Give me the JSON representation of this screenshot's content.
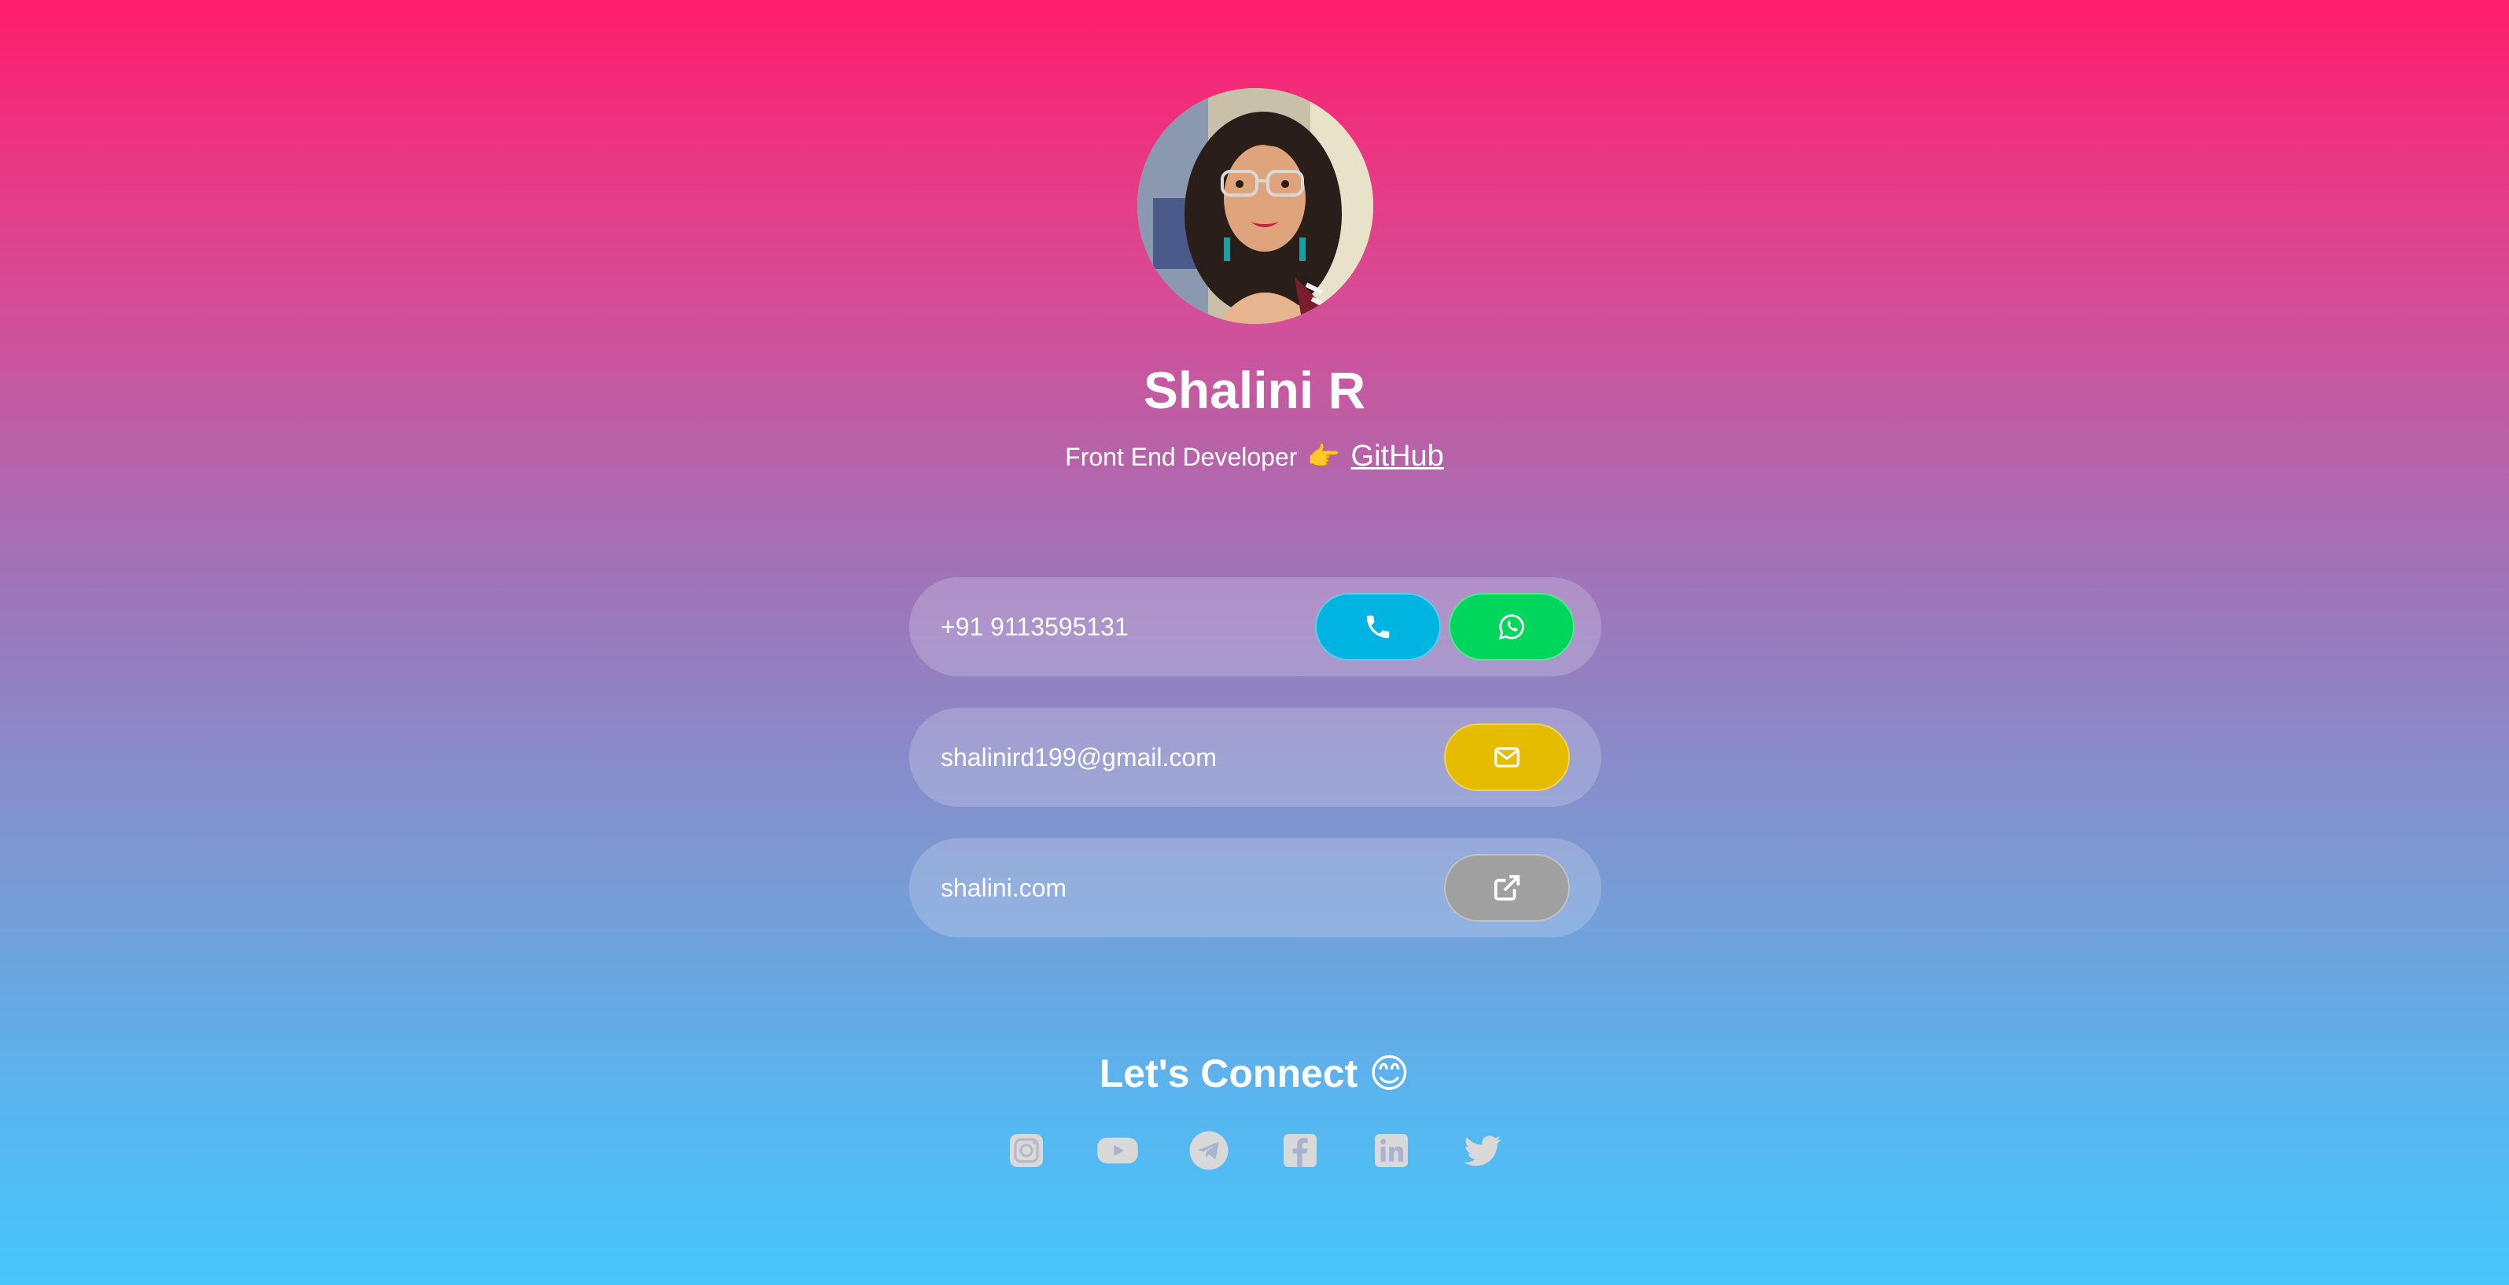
{
  "profile": {
    "name": "Shalini R",
    "role": "Front End Developer",
    "pointer_emoji": "👉",
    "github_label": "GitHub"
  },
  "contacts": {
    "phone": "+91 9113595131",
    "email": "shalinird199@gmail.com",
    "website": "shalini.com"
  },
  "connect": {
    "heading": "Let's Connect",
    "emoji": "😊",
    "socials": [
      "instagram-icon",
      "youtube-icon",
      "telegram-icon",
      "facebook-icon",
      "linkedin-icon",
      "twitter-icon"
    ]
  },
  "colors": {
    "gradient_top": "#ff1d6c",
    "gradient_bottom": "#45c6fb",
    "call_button": "#00b4e2",
    "whatsapp_button": "#00d65c",
    "mail_button": "#e6bc00",
    "link_button": "#a0a0a0",
    "social_icon": "#d9d9d9"
  }
}
